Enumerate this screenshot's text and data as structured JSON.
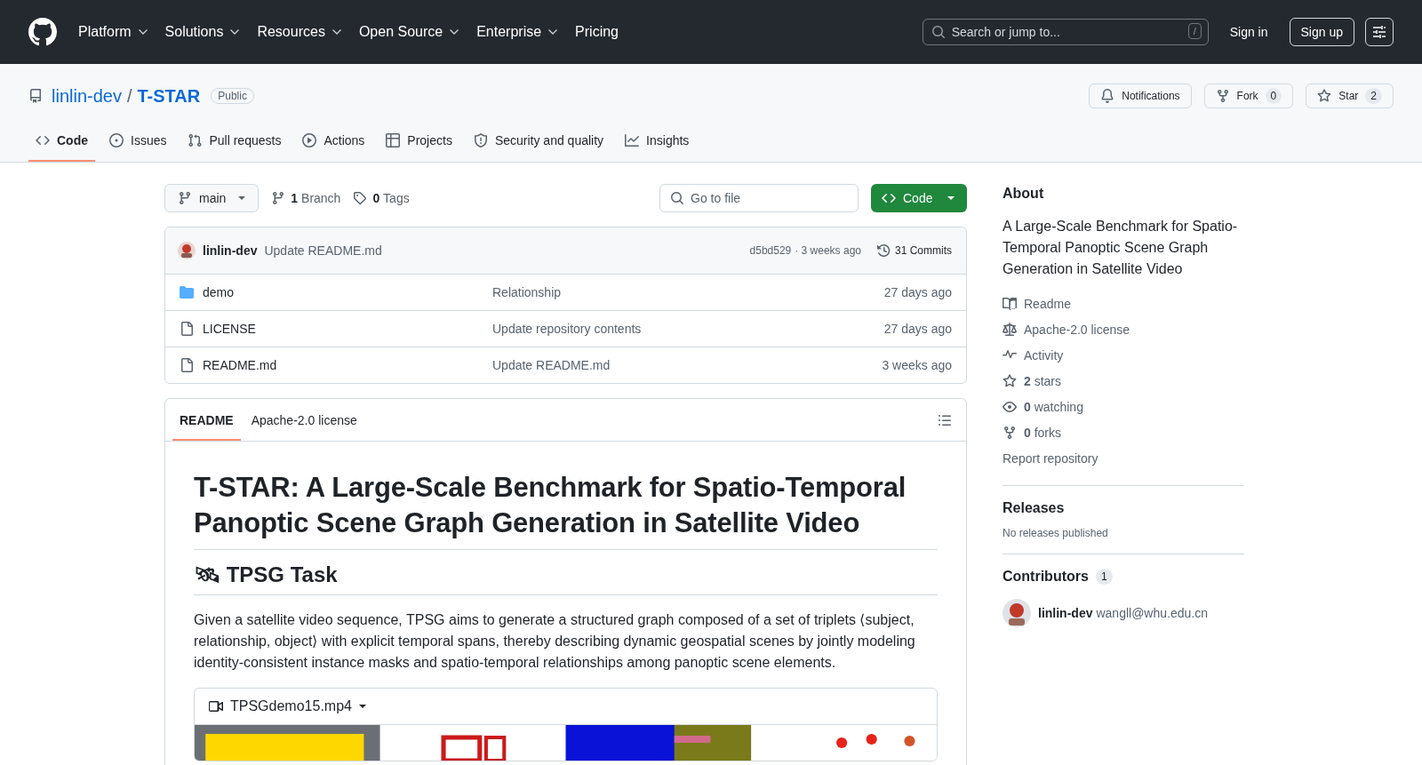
{
  "nav": {
    "items": [
      {
        "label": "Platform",
        "dropdown": true
      },
      {
        "label": "Solutions",
        "dropdown": true
      },
      {
        "label": "Resources",
        "dropdown": true
      },
      {
        "label": "Open Source",
        "dropdown": true
      },
      {
        "label": "Enterprise",
        "dropdown": true
      },
      {
        "label": "Pricing",
        "dropdown": false
      }
    ],
    "search": {
      "placeholder": "Search or jump to...",
      "shortcut": "/"
    },
    "sign_in": "Sign in",
    "sign_up": "Sign up"
  },
  "repo": {
    "owner": "linlin-dev",
    "separator": "/",
    "name": "T-STAR",
    "visibility": "Public",
    "notifications": "Notifications",
    "fork": "Fork",
    "fork_count": "0",
    "star": "Star",
    "star_count": "2"
  },
  "tabs": [
    {
      "label": "Code",
      "selected": true
    },
    {
      "label": "Issues",
      "selected": false
    },
    {
      "label": "Pull requests",
      "selected": false
    },
    {
      "label": "Actions",
      "selected": false
    },
    {
      "label": "Projects",
      "selected": false
    },
    {
      "label": "Security and quality",
      "selected": false
    },
    {
      "label": "Insights",
      "selected": false
    }
  ],
  "toolbar": {
    "branch": "main",
    "branch_count": "1",
    "branch_label": "Branch",
    "tag_count": "0",
    "tag_label": "Tags",
    "file_search": {
      "placeholder": "Go to file"
    },
    "code_button": "Code"
  },
  "commit": {
    "author": "linlin-dev",
    "message": "Update README.md",
    "hash": "d5bd529",
    "age": "· 3 weeks ago",
    "commits": "31 Commits"
  },
  "files": [
    {
      "kind": "folder",
      "name": "demo",
      "message": "Relationship",
      "age": "27 days ago"
    },
    {
      "kind": "file",
      "name": "LICENSE",
      "message": "Update repository contents",
      "age": "27 days ago"
    },
    {
      "kind": "file",
      "name": "README.md",
      "message": "Update README.md",
      "age": "3 weeks ago"
    }
  ],
  "readme": {
    "tabs": [
      {
        "label": "README",
        "selected": true
      },
      {
        "label": "Apache-2.0 license",
        "selected": false
      }
    ],
    "title": "T-STAR: A Large-Scale Benchmark for Spatio-Temporal Panoptic Scene Graph Generation in Satellite Video",
    "section": "🛰 TPSG Task",
    "paragraph": "Given a satellite video sequence, TPSG aims to generate a structured graph composed of a set of triplets ⟨subject, relationship, object⟩ with explicit temporal spans, thereby describing dynamic geospatial scenes by jointly modeling identity-consistent instance masks and spatio-temporal relationships among panoptic scene elements.",
    "video": {
      "name": "TPSGdemo15.mp4",
      "kind": "picture"
    }
  },
  "about": {
    "title": "About",
    "description": "A Large-Scale Benchmark for Spatio-Temporal Panoptic Scene Graph Generation in Satellite Video",
    "links": [
      {
        "label": "Readme"
      },
      {
        "label": "Apache-2.0 license"
      },
      {
        "label": "Activity"
      },
      {
        "count": "2",
        "label": "stars"
      },
      {
        "count": "0",
        "label": "watching"
      },
      {
        "count": "0",
        "label": "forks"
      }
    ],
    "report": "Report repository"
  },
  "releases": {
    "title": "Releases",
    "empty": "No releases published"
  },
  "contributors": {
    "title": "Contributors",
    "count": "1",
    "items": [
      {
        "name": "linlin-dev",
        "email": "wangll@whu.edu.cn"
      }
    ]
  }
}
